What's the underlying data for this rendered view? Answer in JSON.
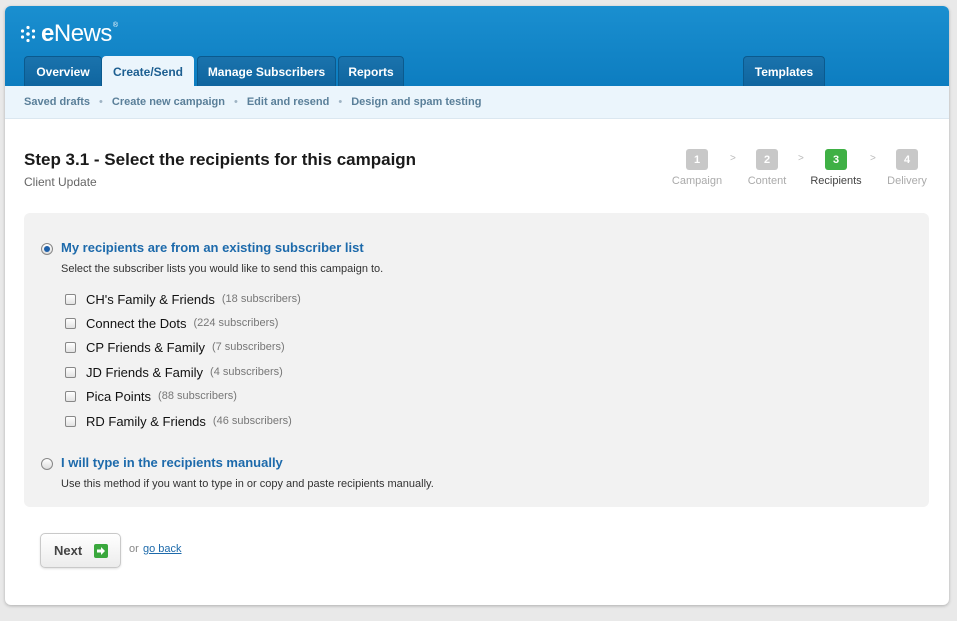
{
  "brand": {
    "name_prefix": "e",
    "name_rest": "News",
    "trademark": "®"
  },
  "tabs": [
    {
      "label": "Overview",
      "active": false
    },
    {
      "label": "Create/Send",
      "active": true
    },
    {
      "label": "Manage Subscribers",
      "active": false
    },
    {
      "label": "Reports",
      "active": false
    },
    {
      "label": "Templates",
      "active": false
    }
  ],
  "subnav": [
    "Saved drafts",
    "Create new campaign",
    "Edit and resend",
    "Design and spam testing"
  ],
  "subnav_separator": "•",
  "page": {
    "title": "Step 3.1 - Select the recipients for this campaign",
    "subtitle": "Client Update"
  },
  "steps": [
    {
      "num": "1",
      "label": "Campaign",
      "current": false
    },
    {
      "num": "2",
      "label": "Content",
      "current": false
    },
    {
      "num": "3",
      "label": "Recipients",
      "current": true
    },
    {
      "num": "4",
      "label": "Delivery",
      "current": false
    }
  ],
  "step_arrow": ">",
  "option_existing": {
    "label": "My recipients are from an existing subscriber list",
    "desc": "Select the subscriber lists you would like to send this campaign to.",
    "selected": true
  },
  "lists": [
    {
      "name": "CH's Family & Friends",
      "count": "(18 subscribers)"
    },
    {
      "name": "Connect the Dots",
      "count": "(224 subscribers)"
    },
    {
      "name": "CP Friends & Family",
      "count": "(7 subscribers)"
    },
    {
      "name": "JD Friends & Family",
      "count": "(4 subscribers)"
    },
    {
      "name": "Pica Points",
      "count": "(88 subscribers)"
    },
    {
      "name": "RD Family & Friends",
      "count": "(46 subscribers)"
    }
  ],
  "option_manual": {
    "label": "I will type in the recipients manually",
    "desc": "Use this method if you want to type in or copy and paste recipients manually.",
    "selected": false
  },
  "actions": {
    "next_label": "Next",
    "or_text": "or",
    "go_back_label": "go back"
  },
  "colors": {
    "header_blue": "#0d7dc0",
    "link_blue": "#1d6aab",
    "step_current": "#3fb045",
    "next_icon": "#3aa83d"
  }
}
